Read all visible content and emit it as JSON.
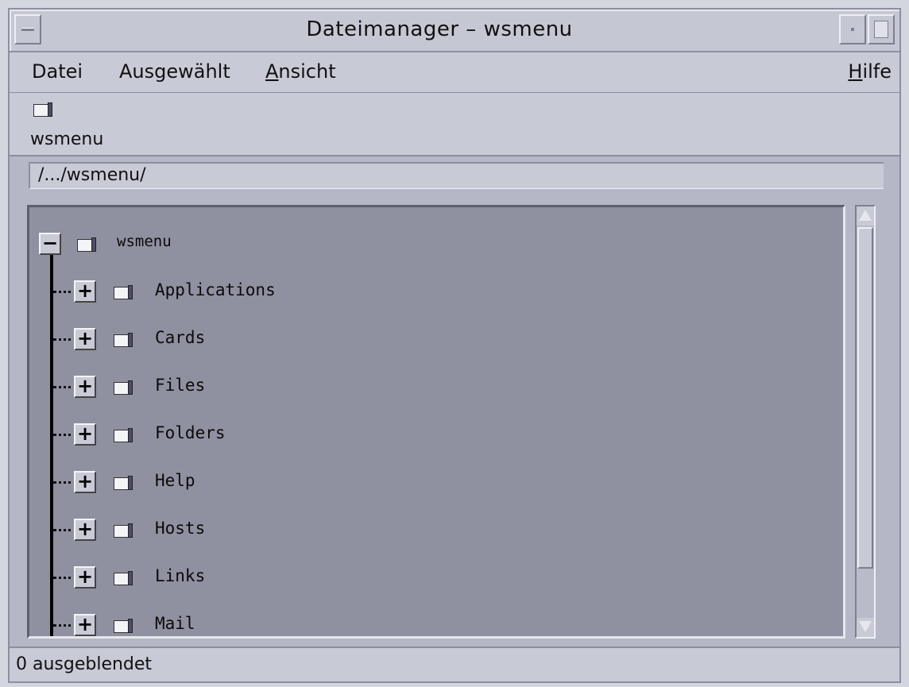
{
  "window": {
    "title": "Dateimanager – wsmenu"
  },
  "menubar": {
    "datei": "Datei",
    "ausgewaehlt": "Ausgewählt",
    "ansicht": "Ansicht",
    "hilfe": "Hilfe"
  },
  "iconstrip": {
    "folder_icon": "folder-icon",
    "label": "wsmenu"
  },
  "path": {
    "value": "/.../wsmenu/"
  },
  "tree": {
    "root": {
      "label": "wsmenu",
      "expander": "−"
    },
    "children": [
      {
        "label": "Applications",
        "expander": "+"
      },
      {
        "label": "Cards",
        "expander": "+"
      },
      {
        "label": "Files",
        "expander": "+"
      },
      {
        "label": "Folders",
        "expander": "+"
      },
      {
        "label": "Help",
        "expander": "+"
      },
      {
        "label": "Hosts",
        "expander": "+"
      },
      {
        "label": "Links",
        "expander": "+"
      },
      {
        "label": "Mail",
        "expander": "+"
      }
    ]
  },
  "status": {
    "text": "0 ausgeblendet"
  },
  "colors": {
    "window_bg": "#b5b7c6",
    "pane_bg": "#8f91a0",
    "folder_side": "#4b4d6b"
  }
}
